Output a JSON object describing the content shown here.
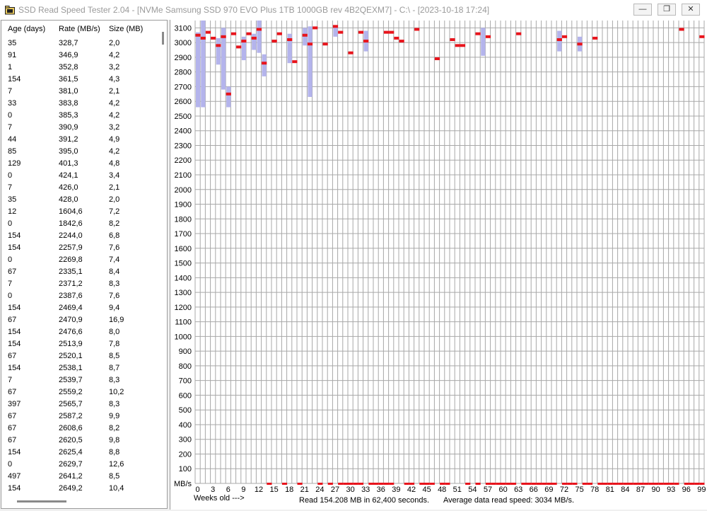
{
  "window": {
    "title": "SSD Read Speed Tester 2.04 - [NVMe Samsung SSD 970 EVO Plus 1TB 1000GB rev 4B2QEXM7] - C:\\ - [2023-10-18 17:24]",
    "controls": [
      "minimize",
      "maximize",
      "close"
    ]
  },
  "table": {
    "headers": {
      "age": "Age (days)",
      "rate": "Rate (MB/s)",
      "size": "Size (MB)"
    },
    "rows": [
      [
        "35",
        "328,7",
        "2,0"
      ],
      [
        "91",
        "346,9",
        "4,2"
      ],
      [
        "1",
        "352,8",
        "3,2"
      ],
      [
        "154",
        "361,5",
        "4,3"
      ],
      [
        "7",
        "381,0",
        "2,1"
      ],
      [
        "33",
        "383,8",
        "4,2"
      ],
      [
        "0",
        "385,3",
        "4,2"
      ],
      [
        "7",
        "390,9",
        "3,2"
      ],
      [
        "44",
        "391,2",
        "4,9"
      ],
      [
        "85",
        "395,0",
        "4,2"
      ],
      [
        "129",
        "401,3",
        "4,8"
      ],
      [
        "0",
        "424,1",
        "3,4"
      ],
      [
        "7",
        "426,0",
        "2,1"
      ],
      [
        "35",
        "428,0",
        "2,0"
      ],
      [
        "12",
        "1604,6",
        "7,2"
      ],
      [
        "0",
        "1842,6",
        "8,2"
      ],
      [
        "154",
        "2244,0",
        "6,8"
      ],
      [
        "154",
        "2257,9",
        "7,6"
      ],
      [
        "0",
        "2269,8",
        "7,4"
      ],
      [
        "67",
        "2335,1",
        "8,4"
      ],
      [
        "7",
        "2371,2",
        "8,3"
      ],
      [
        "0",
        "2387,6",
        "7,6"
      ],
      [
        "154",
        "2469,4",
        "9,4"
      ],
      [
        "67",
        "2470,9",
        "16,9"
      ],
      [
        "154",
        "2476,6",
        "8,0"
      ],
      [
        "154",
        "2513,9",
        "7,8"
      ],
      [
        "67",
        "2520,1",
        "8,5"
      ],
      [
        "154",
        "2538,1",
        "8,7"
      ],
      [
        "7",
        "2539,7",
        "8,3"
      ],
      [
        "67",
        "2559,2",
        "10,2"
      ],
      [
        "397",
        "2565,7",
        "8,3"
      ],
      [
        "67",
        "2587,2",
        "9,9"
      ],
      [
        "67",
        "2608,6",
        "8,2"
      ],
      [
        "67",
        "2620,5",
        "9,8"
      ],
      [
        "154",
        "2625,4",
        "8,8"
      ],
      [
        "0",
        "2629,7",
        "12,6"
      ],
      [
        "497",
        "2641,2",
        "8,5"
      ],
      [
        "154",
        "2649,2",
        "10,4"
      ]
    ]
  },
  "footer": {
    "axis_caption": "Weeks old --->",
    "read_summary": "Read 154.208 MB in 62,400 seconds.",
    "average": "Average data read speed: 3034 MB/s."
  },
  "colors": {
    "mean": "#e8141c",
    "range": "#b4b4ec",
    "grid": "#a8a8a8"
  },
  "chart_data": {
    "type": "range-bar",
    "ylabel": "MB/s",
    "xlabel": "Weeks old --->",
    "ylim": [
      0,
      3150
    ],
    "yticks": [
      100,
      200,
      300,
      400,
      500,
      600,
      700,
      800,
      900,
      1000,
      1100,
      1200,
      1300,
      1400,
      1500,
      1600,
      1700,
      1800,
      1900,
      2000,
      2100,
      2200,
      2300,
      2400,
      2500,
      2600,
      2700,
      2800,
      2900,
      3000,
      3100
    ],
    "xlim": [
      0,
      99
    ],
    "xticks": [
      0,
      3,
      6,
      9,
      12,
      15,
      18,
      21,
      24,
      27,
      30,
      33,
      36,
      39,
      42,
      45,
      48,
      51,
      54,
      57,
      60,
      63,
      66,
      69,
      72,
      75,
      78,
      81,
      84,
      87,
      90,
      93,
      96,
      99
    ],
    "ranges": [
      {
        "week": 0,
        "lo": 2560,
        "hi": 3070
      },
      {
        "week": 1,
        "lo": 2560,
        "hi": 3150
      },
      {
        "week": 4,
        "lo": 2850,
        "hi": 3030
      },
      {
        "week": 5,
        "lo": 2680,
        "hi": 3100
      },
      {
        "week": 6,
        "lo": 2560,
        "hi": 2700
      },
      {
        "week": 9,
        "lo": 2880,
        "hi": 3040
      },
      {
        "week": 11,
        "lo": 2950,
        "hi": 3060
      },
      {
        "week": 12,
        "lo": 2930,
        "hi": 3150
      },
      {
        "week": 13,
        "lo": 2770,
        "hi": 2920
      },
      {
        "week": 18,
        "lo": 2860,
        "hi": 3060
      },
      {
        "week": 21,
        "lo": 2980,
        "hi": 3100
      },
      {
        "week": 22,
        "lo": 2630,
        "hi": 3110
      },
      {
        "week": 27,
        "lo": 3040,
        "hi": 3110
      },
      {
        "week": 33,
        "lo": 2940,
        "hi": 3080
      },
      {
        "week": 56,
        "lo": 2910,
        "hi": 3100
      },
      {
        "week": 71,
        "lo": 2940,
        "hi": 3080
      },
      {
        "week": 75,
        "lo": 2940,
        "hi": 3040
      }
    ],
    "means": [
      {
        "week": 0,
        "value": 3050
      },
      {
        "week": 1,
        "value": 3030
      },
      {
        "week": 2,
        "value": 3070
      },
      {
        "week": 3,
        "value": 3030
      },
      {
        "week": 4,
        "value": 2980
      },
      {
        "week": 5,
        "value": 3040
      },
      {
        "week": 6,
        "value": 2650
      },
      {
        "week": 7,
        "value": 3060
      },
      {
        "week": 8,
        "value": 2970
      },
      {
        "week": 9,
        "value": 3010
      },
      {
        "week": 10,
        "value": 3060
      },
      {
        "week": 11,
        "value": 3030
      },
      {
        "week": 12,
        "value": 3090
      },
      {
        "week": 13,
        "value": 2860
      },
      {
        "week": 15,
        "value": 3010
      },
      {
        "week": 16,
        "value": 3060
      },
      {
        "week": 18,
        "value": 3020
      },
      {
        "week": 19,
        "value": 2870
      },
      {
        "week": 21,
        "value": 3050
      },
      {
        "week": 22,
        "value": 2990
      },
      {
        "week": 23,
        "value": 3100
      },
      {
        "week": 25,
        "value": 2990
      },
      {
        "week": 27,
        "value": 3110
      },
      {
        "week": 28,
        "value": 3070
      },
      {
        "week": 30,
        "value": 2930
      },
      {
        "week": 32,
        "value": 3070
      },
      {
        "week": 33,
        "value": 3010
      },
      {
        "week": 37,
        "value": 3070
      },
      {
        "week": 38,
        "value": 3070
      },
      {
        "week": 39,
        "value": 3030
      },
      {
        "week": 40,
        "value": 3010
      },
      {
        "week": 43,
        "value": 3090
      },
      {
        "week": 47,
        "value": 2890
      },
      {
        "week": 50,
        "value": 3020
      },
      {
        "week": 51,
        "value": 2980
      },
      {
        "week": 52,
        "value": 2980
      },
      {
        "week": 55,
        "value": 3060
      },
      {
        "week": 57,
        "value": 3040
      },
      {
        "week": 63,
        "value": 3060
      },
      {
        "week": 71,
        "value": 3020
      },
      {
        "week": 72,
        "value": 3040
      },
      {
        "week": 75,
        "value": 2990
      },
      {
        "week": 78,
        "value": 3030
      },
      {
        "week": 95,
        "value": 3090
      },
      {
        "week": 99,
        "value": 3040
      }
    ],
    "zero_weeks": [
      14,
      17,
      20,
      24,
      26,
      28,
      29,
      30,
      31,
      32,
      34,
      35,
      36,
      37,
      38,
      41,
      42,
      44,
      45,
      46,
      48,
      49,
      53,
      55,
      57,
      58,
      59,
      60,
      61,
      62,
      64,
      65,
      66,
      67,
      68,
      69,
      70,
      72,
      73,
      74,
      76,
      77,
      79,
      80,
      81,
      82,
      83,
      84,
      85,
      86,
      87,
      88,
      89,
      90,
      91,
      92,
      93,
      94,
      96,
      97,
      98,
      99
    ]
  }
}
